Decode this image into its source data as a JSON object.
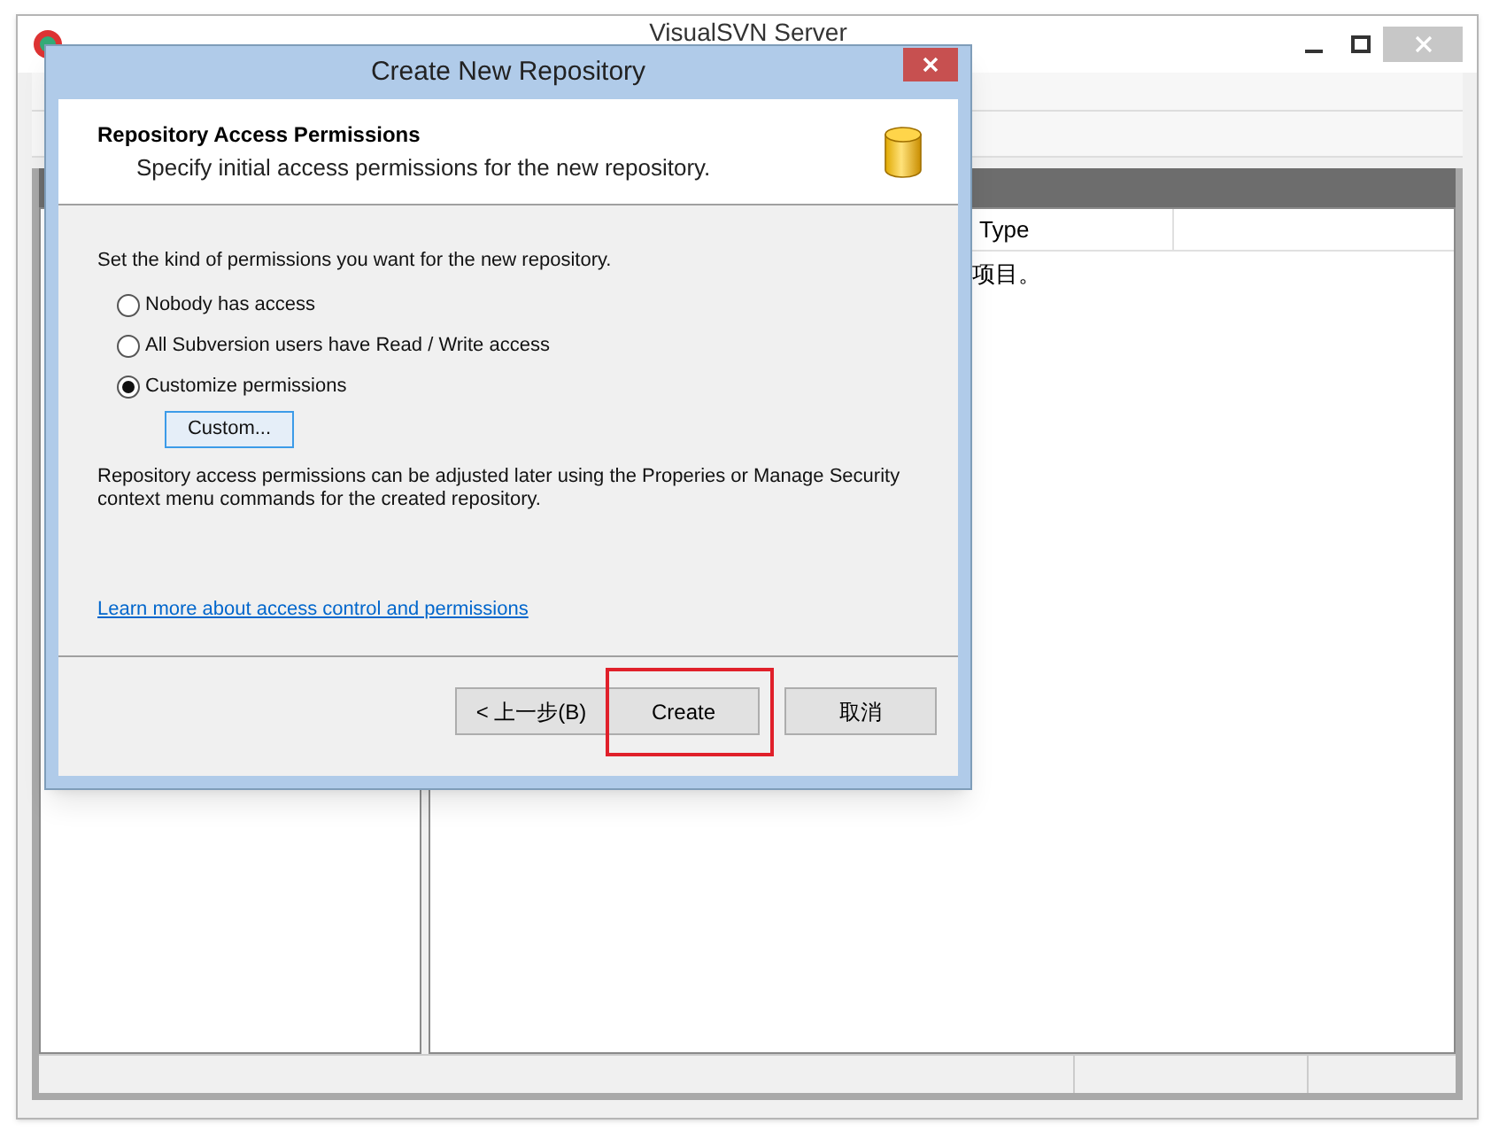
{
  "window": {
    "title": "VisualSVN Server"
  },
  "list": {
    "columns": [
      "Type"
    ],
    "rows": [
      "项目。"
    ]
  },
  "dialog": {
    "title": "Create New Repository",
    "header": {
      "title": "Repository Access Permissions",
      "subtitle": "Specify initial access permissions for the new repository."
    },
    "prompt": "Set the kind of permissions you want for the new repository.",
    "options": [
      {
        "label": "Nobody has access",
        "selected": false
      },
      {
        "label": "All Subversion users have Read / Write access",
        "selected": false
      },
      {
        "label": "Customize permissions",
        "selected": true
      }
    ],
    "custom_button": "Custom...",
    "note": "Repository access permissions can be adjusted later using the Properies or Manage Security context menu commands for the created repository.",
    "link": "Learn more about access control and permissions",
    "buttons": [
      {
        "label": "< 上一步(B)",
        "highlighted": false
      },
      {
        "label": "Create",
        "highlighted": true
      },
      {
        "label": "取消",
        "highlighted": false
      }
    ]
  }
}
